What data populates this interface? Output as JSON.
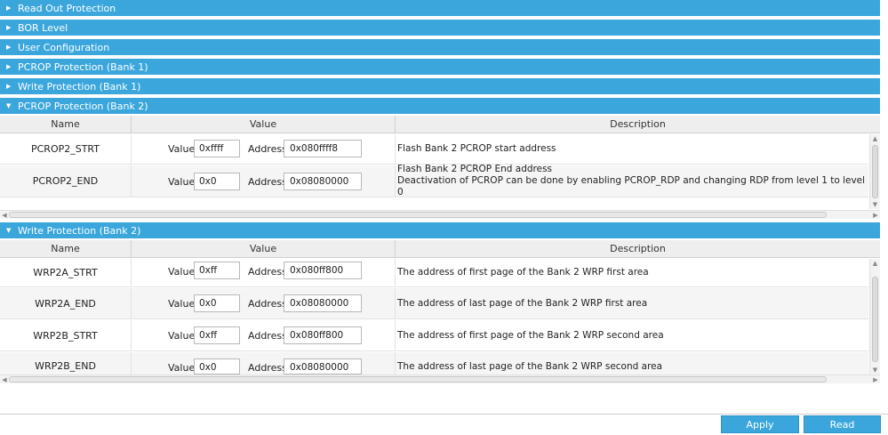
{
  "collapsed_sections": [
    {
      "label": "Read Out Protection"
    },
    {
      "label": "BOR Level"
    },
    {
      "label": "User Configuration"
    },
    {
      "label": "PCROP Protection (Bank 1)"
    },
    {
      "label": "Write Protection (Bank 1)"
    }
  ],
  "pcrop_bank2": {
    "title": "PCROP Protection (Bank 2)",
    "columns": {
      "name": "Name",
      "value": "Value",
      "description": "Description"
    },
    "rows": [
      {
        "name": "PCROP2_STRT",
        "value_label": "Value",
        "value": "0xffff",
        "address_label": "Address",
        "address": "0x080ffff8",
        "desc1": "Flash Bank 2 PCROP start address",
        "desc2": ""
      },
      {
        "name": "PCROP2_END",
        "value_label": "Value",
        "value": "0x0",
        "address_label": "Address",
        "address": "0x08080000",
        "desc1": "Flash Bank 2 PCROP End address",
        "desc2": "Deactivation of PCROP can be done by enabling PCROP_RDP and changing RDP from level 1 to level 0"
      }
    ]
  },
  "wrp_bank2": {
    "title": "Write Protection (Bank 2)",
    "columns": {
      "name": "Name",
      "value": "Value",
      "description": "Description"
    },
    "rows": [
      {
        "name": "WRP2A_STRT",
        "value_label": "Value",
        "value": "0xff",
        "address_label": "Address",
        "address": "0x080ff800",
        "desc1": "The address of first page of the Bank 2 WRP first area"
      },
      {
        "name": "WRP2A_END",
        "value_label": "Value",
        "value": "0x0",
        "address_label": "Address",
        "address": "0x08080000",
        "desc1": "The address of last page of the Bank 2 WRP first area"
      },
      {
        "name": "WRP2B_STRT",
        "value_label": "Value",
        "value": "0xff",
        "address_label": "Address",
        "address": "0x080ff800",
        "desc1": "The address of first page of the Bank 2 WRP second area"
      },
      {
        "name": "WRP2B_END",
        "value_label": "Value",
        "value": "0x0",
        "address_label": "Address",
        "address": "0x08080000",
        "desc1": "The address of last page of the Bank 2 WRP second area"
      }
    ]
  },
  "icons": {
    "collapsed": "triangle-right",
    "expanded": "triangle-down"
  },
  "buttons": {
    "apply": "Apply",
    "read": "Read"
  },
  "colors": {
    "header_blue": "#3ba6dc",
    "column_header": "#eeeeee"
  }
}
